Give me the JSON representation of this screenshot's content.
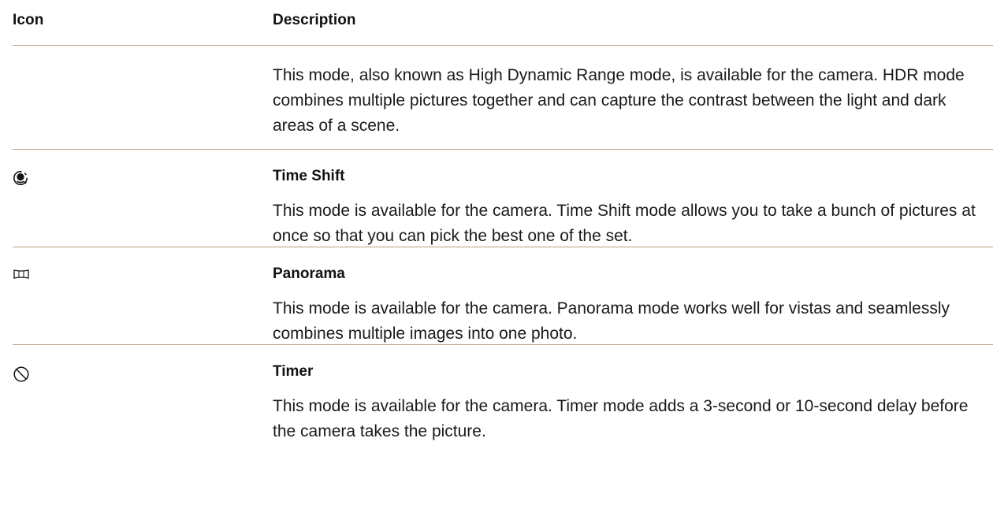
{
  "table": {
    "headers": {
      "icon": "Icon",
      "description": "Description"
    },
    "rows": [
      {
        "icon": "",
        "title": "",
        "text": "This mode, also known as High Dynamic Range mode, is available for the camera. HDR mode combines multiple pictures together and can capture the contrast between the light and dark areas of a scene."
      },
      {
        "icon": "time-shift-icon",
        "title": "Time Shift",
        "text": "This mode is available for the camera. Time Shift mode allows you to take a bunch of pictures at once so that you can pick the best one of the set."
      },
      {
        "icon": "panorama-icon",
        "title": "Panorama",
        "text": "This mode is available for the camera. Panorama mode works well for vistas and seamlessly combines multiple images into one photo."
      },
      {
        "icon": "timer-icon",
        "title": "Timer",
        "text": "This mode is available for the camera. Timer mode adds a 3-second or 10-second delay before the camera takes the picture."
      }
    ]
  },
  "colors": {
    "divider": "#b89f7e",
    "text": "#111111"
  }
}
